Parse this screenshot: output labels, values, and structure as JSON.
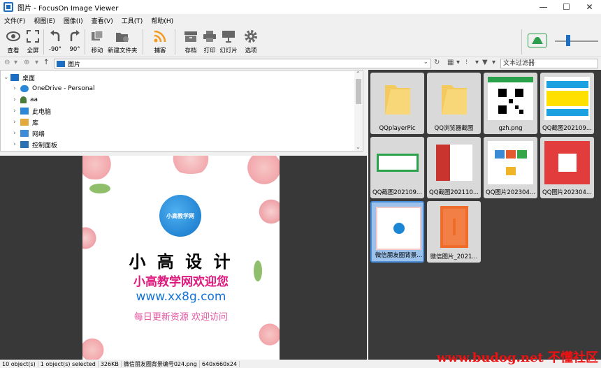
{
  "window": {
    "title": "图片 - FocusOn Image Viewer",
    "minimize": "—",
    "maximize": "☐",
    "close": "✕"
  },
  "menu": [
    "文件(F)",
    "视图(E)",
    "图像(I)",
    "查看(V)",
    "工具(T)",
    "帮助(H)"
  ],
  "toolbar": {
    "view": "查看",
    "fullscreen": "全屏",
    "rotate_left": "-90°",
    "rotate_right": "90°",
    "move": "移动",
    "new_folder": "新建文件夹",
    "capture": "捕客",
    "save": "存档",
    "print": "打印",
    "slideshow": "幻灯片",
    "options": "选项"
  },
  "address": {
    "path": "图片",
    "filter_placeholder": "文本过滤器"
  },
  "tree": [
    "桌面",
    "OneDrive - Personal",
    "aa",
    "此电脑",
    "库",
    "网络",
    "控制面板"
  ],
  "colors": {
    "accent": "#1b6ec2",
    "selection": "#9cc1ea",
    "dark_bg": "#3a3a3a"
  },
  "preview": {
    "logo_text": "小高教学网",
    "title": "小 高 设 计",
    "subtitle": "小高教学网欢迎您",
    "url": "www.xx8g.com",
    "tagline": "每日更新资源 欢迎访问"
  },
  "thumbnails": [
    {
      "label": "QQplayerPic",
      "kind": "folder"
    },
    {
      "label": "QQ浏览器截图",
      "kind": "folder"
    },
    {
      "label": "gzh.png",
      "kind": "qr"
    },
    {
      "label": "QQ截图202109...",
      "kind": "poster"
    },
    {
      "label": "QQ截图202109...",
      "kind": "green"
    },
    {
      "label": "QQ截图202110...",
      "kind": "doc"
    },
    {
      "label": "QQ图片202304...",
      "kind": "collage"
    },
    {
      "label": "QQ图片202304...",
      "kind": "red"
    },
    {
      "label": "微信朋友圈背景...",
      "kind": "selected"
    },
    {
      "label": "微信图片_2021...",
      "kind": "orange"
    }
  ],
  "status": {
    "count": "10 object(s)",
    "selected": "1 object(s) selected",
    "size": "326KB",
    "filename": "微信朋友圈背景编号024.png",
    "dims": "640x660x24"
  },
  "watermark": "www.budog.net 不懂社区"
}
